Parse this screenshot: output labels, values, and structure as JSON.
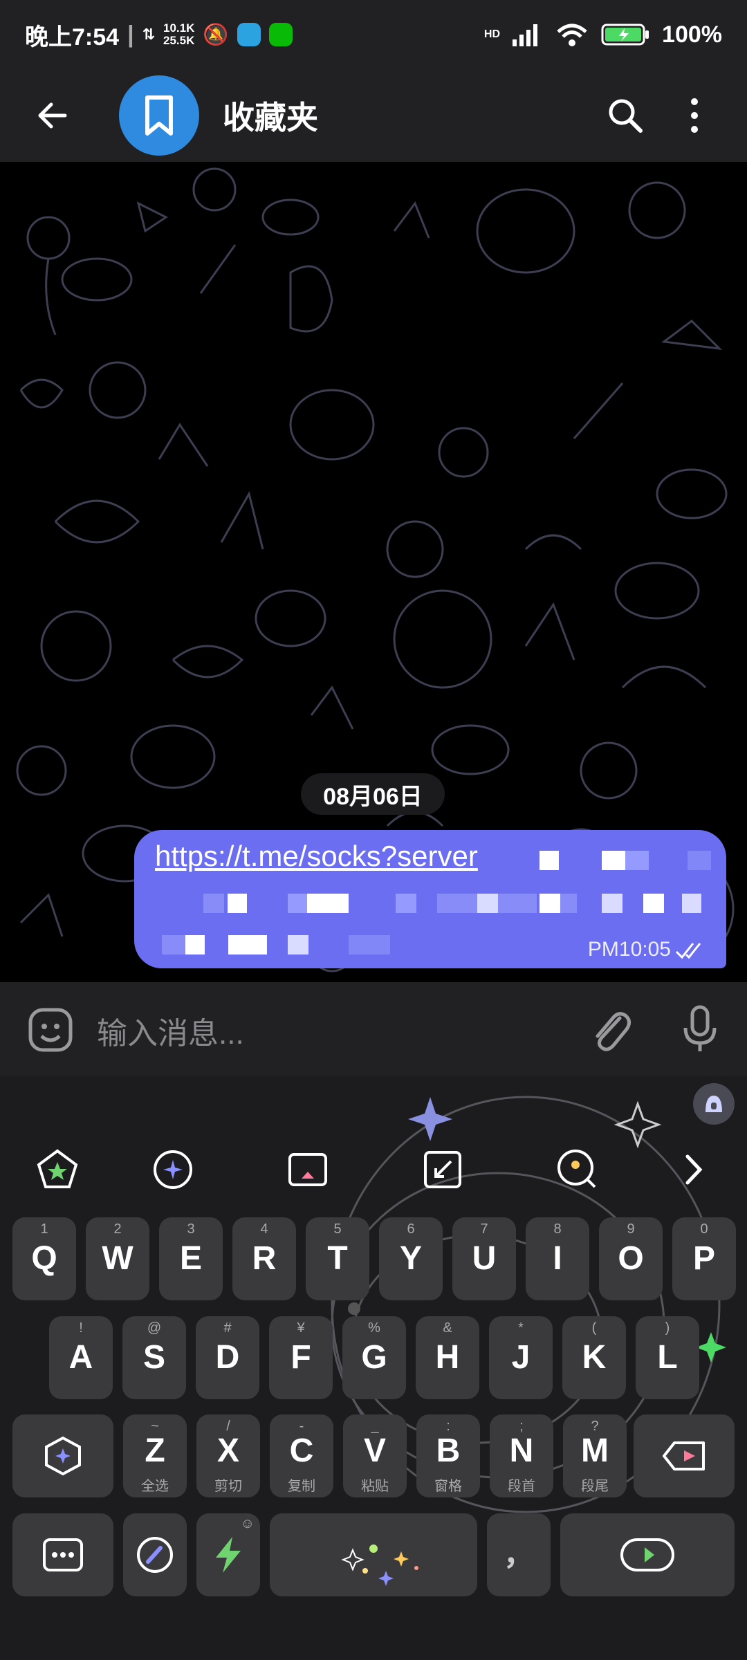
{
  "status_bar": {
    "time": "晚上7:54",
    "speed_up": "10.1K",
    "speed_down": "25.5K",
    "network": "HD",
    "battery": "100%"
  },
  "header": {
    "title": "收藏夹",
    "back_icon": "back-arrow-icon",
    "avatar_icon": "bookmark-icon"
  },
  "chat": {
    "date": "08月06日",
    "message": {
      "link_text": "https://t.me/socks?server",
      "time": "PM10:05"
    }
  },
  "composer": {
    "placeholder": "输入消息..."
  },
  "keyboard": {
    "row1": [
      {
        "key": "Q",
        "sup": "1"
      },
      {
        "key": "W",
        "sup": "2"
      },
      {
        "key": "E",
        "sup": "3"
      },
      {
        "key": "R",
        "sup": "4"
      },
      {
        "key": "T",
        "sup": "5"
      },
      {
        "key": "Y",
        "sup": "6"
      },
      {
        "key": "U",
        "sup": "7"
      },
      {
        "key": "I",
        "sup": "8"
      },
      {
        "key": "O",
        "sup": "9"
      },
      {
        "key": "P",
        "sup": "0"
      }
    ],
    "row2": [
      {
        "key": "A",
        "sup": "!"
      },
      {
        "key": "S",
        "sup": "@"
      },
      {
        "key": "D",
        "sup": "#"
      },
      {
        "key": "F",
        "sup": "¥"
      },
      {
        "key": "G",
        "sup": "%"
      },
      {
        "key": "H",
        "sup": "&"
      },
      {
        "key": "J",
        "sup": "*"
      },
      {
        "key": "K",
        "sup": "("
      },
      {
        "key": "L",
        "sup": ")"
      }
    ],
    "row3": [
      {
        "key": "Z",
        "sup": "~",
        "sub": "全选"
      },
      {
        "key": "X",
        "sup": "/",
        "sub": "剪切"
      },
      {
        "key": "C",
        "sup": "-",
        "sub": "复制"
      },
      {
        "key": "V",
        "sup": "_",
        "sub": "粘贴"
      },
      {
        "key": "B",
        "sup": ":",
        "sub": "窗格"
      },
      {
        "key": "N",
        "sup": ";",
        "sub": "段首"
      },
      {
        "key": "M",
        "sup": "?",
        "sub": "段尾"
      }
    ],
    "comma": "，"
  },
  "colors": {
    "bar_bg": "#212123",
    "bubble": "#6b6ef0",
    "avatar": "#2f8be0",
    "key_bg": "#3a3a3c"
  }
}
